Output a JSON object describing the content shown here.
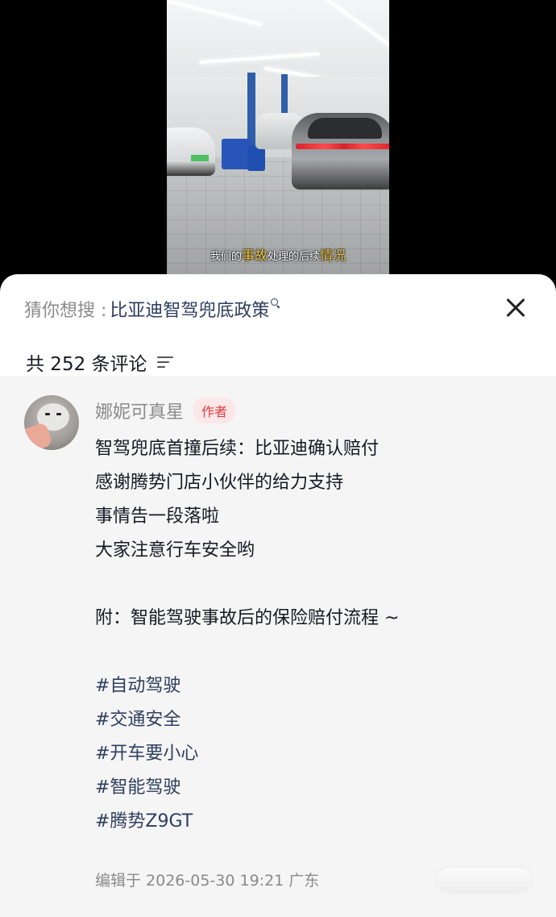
{
  "video": {
    "subtitle": {
      "part1": "我们的",
      "part2": "事故",
      "part3": "处理的后续",
      "part4": "情况"
    }
  },
  "suggest": {
    "label": "猜你想搜 :",
    "query": "比亚迪智驾兜底政策",
    "icon": "search-icon"
  },
  "comments_header": {
    "count_text": "共 252 条评论",
    "sort_icon": "sort-icon",
    "close_icon": "close-icon"
  },
  "comment": {
    "author": "娜妮可真星",
    "badge": "作者",
    "lines": [
      "智驾兜底首撞后续：比亚迪确认赔付",
      "感谢腾势门店小伙伴的给力支持",
      "事情告一段落啦",
      "大家注意行车安全哟",
      "",
      "附：智能驾驶事故后的保险赔付流程 ~",
      ""
    ],
    "tags": [
      "#自动驾驶",
      "#交通安全",
      "#开车要小心",
      "#智能驾驶",
      "#腾势Z9GT"
    ],
    "meta": "编辑于  2026-05-30 19:21  广东"
  },
  "colors": {
    "tag_blue": "#2d3e5e",
    "badge_red": "#e4393c",
    "subtitle_yellow": "#f2c744"
  }
}
